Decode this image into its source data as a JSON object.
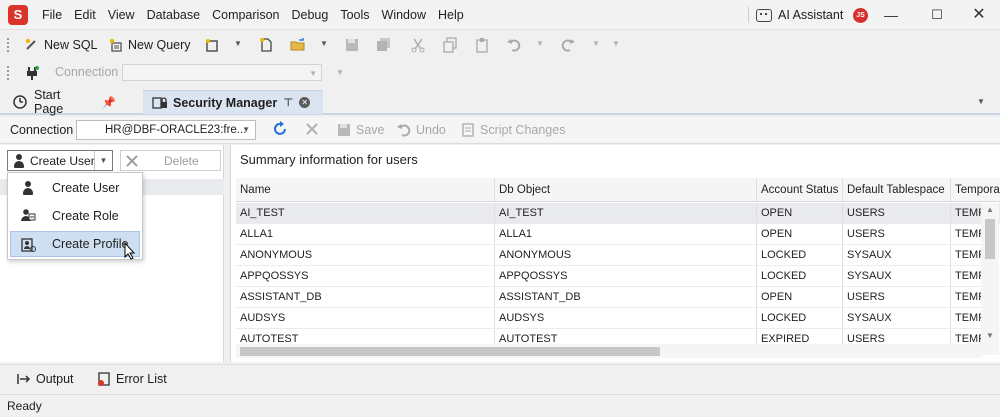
{
  "app": {
    "logo_letter": "S"
  },
  "menu": [
    "File",
    "Edit",
    "View",
    "Database",
    "Comparison",
    "Debug",
    "Tools",
    "Window",
    "Help"
  ],
  "ai_assistant": {
    "label": "AI Assistant",
    "avatar_initials": "JS"
  },
  "toolbar1": {
    "new_sql": "New SQL",
    "new_query": "New Query"
  },
  "toolbar2": {
    "connection_label": "Connection",
    "connection_value": ""
  },
  "tabs": [
    {
      "label": "Start Page",
      "active": false
    },
    {
      "label": "Security Manager",
      "active": true
    }
  ],
  "docbar": {
    "connection_label": "Connection",
    "connection_value": "HR@DBF-ORACLE23:fre...",
    "save": "Save",
    "undo": "Undo",
    "script_changes": "Script Changes"
  },
  "left": {
    "create_user": "Create User",
    "delete": "Delete"
  },
  "dropdown": {
    "items": [
      {
        "label": "Create User",
        "icon": "user-icon"
      },
      {
        "label": "Create Role",
        "icon": "role-icon"
      },
      {
        "label": "Create Profile",
        "icon": "profile-icon",
        "highlighted": true
      }
    ]
  },
  "summary_title": "Summary information for users",
  "grid": {
    "columns": [
      "Name",
      "Db Object",
      "Account Status",
      "Default Tablespace",
      "Tempora"
    ],
    "rows": [
      [
        "AI_TEST",
        "AI_TEST",
        "OPEN",
        "USERS",
        "TEMP"
      ],
      [
        "ALLA1",
        "ALLA1",
        "OPEN",
        "USERS",
        "TEMP"
      ],
      [
        "ANONYMOUS",
        "ANONYMOUS",
        "LOCKED",
        "SYSAUX",
        "TEMP"
      ],
      [
        "APPQOSSYS",
        "APPQOSSYS",
        "LOCKED",
        "SYSAUX",
        "TEMP"
      ],
      [
        "ASSISTANT_DB",
        "ASSISTANT_DB",
        "OPEN",
        "USERS",
        "TEMP"
      ],
      [
        "AUDSYS",
        "AUDSYS",
        "LOCKED",
        "SYSAUX",
        "TEMP"
      ],
      [
        "AUTOTEST",
        "AUTOTEST",
        "EXPIRED",
        "USERS",
        "TEMP"
      ]
    ]
  },
  "bottom": {
    "output": "Output",
    "error_list": "Error List"
  },
  "status": "Ready",
  "colors": {
    "accent": "#1e6fd9",
    "brand": "#d9332a",
    "highlight": "#cfdff2"
  }
}
